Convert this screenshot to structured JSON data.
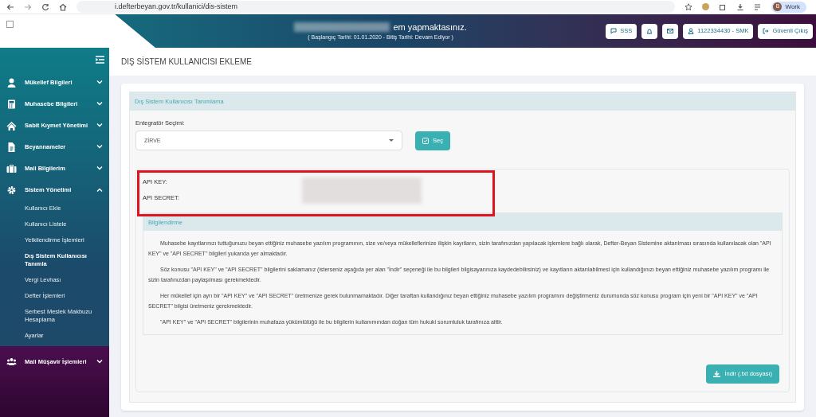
{
  "browser": {
    "url": "i.defterbeyan.gov.tr/kullanici/dis-sistem",
    "profile": "Work",
    "profile_initial": "B"
  },
  "header": {
    "title": "em yapmaktasınız.",
    "subtitle": "( Başlangıç Tarihi: 01.01.2020 - Bitiş Tarihi: Devam Ediyor )",
    "buttons": [
      {
        "kind": "sss",
        "label": "SSS"
      },
      {
        "kind": "bell"
      },
      {
        "kind": "mail"
      },
      {
        "kind": "user",
        "label": "1122334430 - SMK"
      },
      {
        "kind": "logout",
        "label": "Güvenli Çıkış"
      }
    ]
  },
  "sidebar": {
    "items": [
      {
        "label": "Mükellef Bilgileri",
        "expanded": false
      },
      {
        "label": "Muhasebe Bilgileri",
        "expanded": false
      },
      {
        "label": "Sabit Kıymet Yönetimi",
        "expanded": false
      },
      {
        "label": "Beyannameler",
        "expanded": false
      },
      {
        "label": "Mali Bilgilerim",
        "expanded": false
      },
      {
        "label": "Sistem Yönetimi",
        "expanded": true,
        "children": [
          {
            "label": "Kullanıcı Ekle",
            "selected": false
          },
          {
            "label": "Kullanıcı Listele",
            "selected": false
          },
          {
            "label": "Yetkilendirme İşlemleri",
            "selected": false
          },
          {
            "label": "Dış Sistem Kullanıcısı Tanımla",
            "selected": true
          },
          {
            "label": "Vergi Levhası",
            "selected": false
          },
          {
            "label": "Defter İşlemleri",
            "selected": false
          },
          {
            "label": "Serbest Meslek Makbuzu Hesaplama",
            "selected": false
          },
          {
            "label": "Ayarlar",
            "selected": false
          }
        ]
      },
      {
        "label": "Mali Müşavir İşlemleri",
        "expanded": false
      }
    ]
  },
  "page_title": "DIŞ SİSTEM KULLANICISI EKLEME",
  "panel": {
    "title": "Dış Sistem Kullanıcısı Tanımlama",
    "select_label": "Entegratör Seçimi:",
    "select_value": "ZİRVE",
    "select_button": "Seç",
    "api_fields": [
      {
        "label": "API KEY:"
      },
      {
        "label": "API SECRET:"
      }
    ],
    "info_title": "Bilgilendirme",
    "info_paragraphs": [
      "Muhasebe kayıtlarınızı tuttuğunuzu beyan ettiğiniz muhasebe yazılım programının, size ve/veya mükelleflerinize ilişkin kayıtların, sizin tarafınızdan yapılacak işlemlere bağlı olarak, Defter-Beyan Sistemine aktarılması sırasında kullanılacak olan \"API KEY\" ve \"API SECRET\" bilgileri yukarıda yer almaktadır.",
      "Söz konusu \"API KEY\" ve \"API SECRET\" bilgilerini saklamanız (isterseniz aşağıda yer alan \"İndir\" seçeneği ile bu bilgileri bilgisayarınıza kaydedebilirsiniz) ve kayıtların aktarılabilmesi için kullandığınızı beyan ettiğiniz muhasebe yazılım programı ile sizin tarafınızdan paylaşılması gerekmektedir.",
      "Her mükellef için ayrı bir \"API KEY\" ve \"API SECRET\" üretmenize gerek bulunmamaktadır. Diğer taraftan kullandığınız beyan ettiğiniz muhasebe yazılım programını değiştirmeniz durumunda söz konusu program için yeni bir \"API KEY\" ve \"API SECRET\" bilgisi üretmeniz gerekmektedir.",
      "\"API KEY\" ve \"API SECRET\" bilgilerinin muhafaza yükümlülüğü ile bu bilgilerin kullanımından doğan tüm hukuki sorumluluk tarafınıza aittir."
    ],
    "download_button": "İndir (.txt dosyası)"
  }
}
